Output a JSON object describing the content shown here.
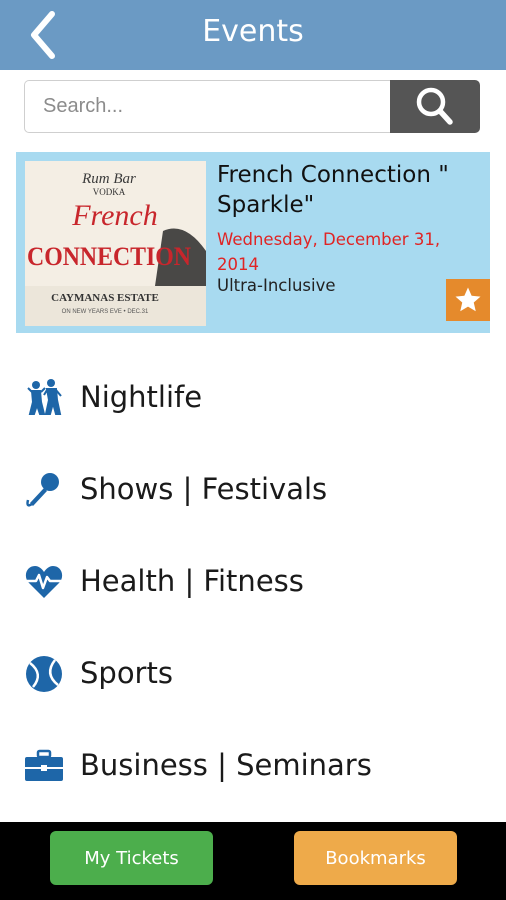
{
  "header": {
    "title": "Events",
    "back_icon": "chevron-left-icon"
  },
  "search": {
    "placeholder": "Search...",
    "icon": "search-icon"
  },
  "featured": {
    "poster": {
      "brand": "Rum Bar",
      "brand2": "VODKA",
      "line1": "French",
      "line2": "CONNECTION",
      "venue": "CAYMANAS ESTATE",
      "sub": "ON NEW YEARS EVE • DEC.31"
    },
    "title": "French Connection \" Sparkle\"",
    "date": "Wednesday, December 31, 2014",
    "type": "Ultra-Inclusive",
    "bookmark_icon": "star-icon",
    "colors": {
      "background": "#a8daf0",
      "date": "#e02424",
      "star_bg": "#e58a2c"
    }
  },
  "categories": [
    {
      "label": "Nightlife",
      "icon": "dancers-icon"
    },
    {
      "label": "Shows | Festivals",
      "icon": "microphone-icon"
    },
    {
      "label": "Health | Fitness",
      "icon": "heartbeat-icon"
    },
    {
      "label": "Sports",
      "icon": "tennis-ball-icon"
    },
    {
      "label": "Business | Seminars",
      "icon": "briefcase-icon"
    }
  ],
  "bottom": {
    "tickets_label": "My Tickets",
    "bookmarks_label": "Bookmarks",
    "colors": {
      "tickets": "#4cae4c",
      "bookmarks": "#eeaa4a"
    }
  },
  "theme": {
    "header": "#6b9ac4",
    "icon": "#1e66a8"
  }
}
